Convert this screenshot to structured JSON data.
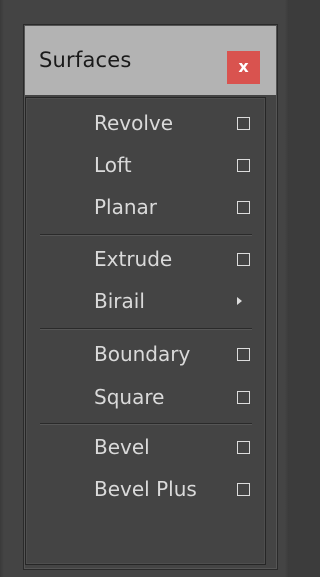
{
  "window": {
    "title": "Surfaces",
    "close_label": "x"
  },
  "menu": {
    "items": [
      {
        "label": "Revolve",
        "has_option_box": true
      },
      {
        "label": "Loft",
        "has_option_box": true
      },
      {
        "label": "Planar",
        "has_option_box": true
      },
      {
        "label": "Extrude",
        "has_option_box": true
      },
      {
        "label": "Birail",
        "has_submenu": true
      },
      {
        "label": "Boundary",
        "has_option_box": true
      },
      {
        "label": "Square",
        "has_option_box": true
      },
      {
        "label": "Bevel",
        "has_option_box": true
      },
      {
        "label": "Bevel Plus",
        "has_option_box": true
      }
    ]
  },
  "colors": {
    "titlebar": "#b3b3b3",
    "close_button": "#d9534f",
    "menu_background": "#444444",
    "menu_text": "#dadada"
  }
}
